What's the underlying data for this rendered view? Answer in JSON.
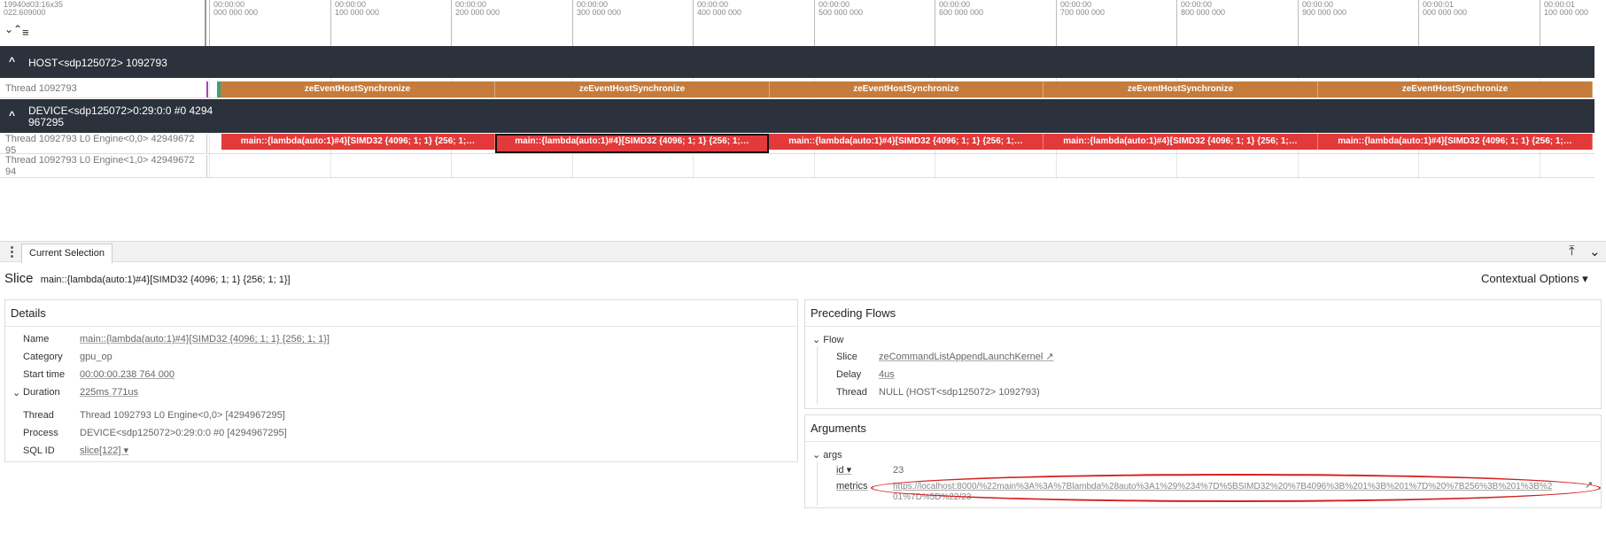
{
  "ruler": {
    "left_top": "19940d03:16x35",
    "left_bottom": "022.609000",
    "ticks": [
      {
        "a": "00:00:00",
        "b": "000 000 000"
      },
      {
        "a": "00:00:00",
        "b": "100 000 000"
      },
      {
        "a": "00:00:00",
        "b": "200 000 000"
      },
      {
        "a": "00:00:00",
        "b": "300 000 000"
      },
      {
        "a": "00:00:00",
        "b": "400 000 000"
      },
      {
        "a": "00:00:00",
        "b": "500 000 000"
      },
      {
        "a": "00:00:00",
        "b": "600 000 000"
      },
      {
        "a": "00:00:00",
        "b": "700 000 000"
      },
      {
        "a": "00:00:00",
        "b": "800 000 000"
      },
      {
        "a": "00:00:00",
        "b": "900 000 000"
      },
      {
        "a": "00:00:01",
        "b": "000 000 000"
      },
      {
        "a": "00:00:01",
        "b": "100 000 000"
      }
    ],
    "collapse_icon": "⌄⌃",
    "filter_icon": "≡"
  },
  "tracks": {
    "host_group": {
      "chevron": "^",
      "label": "HOST<sdp125072> 1092793"
    },
    "host_thread": {
      "name": "Thread 1092793",
      "slice_label": "zeEventHostSynchronize"
    },
    "device_group": {
      "chevron": "^",
      "label_line1": "DEVICE<sdp125072>0:29:0:0 #0 4294",
      "label_line2": "967295"
    },
    "engine0": {
      "name_line1": "Thread 1092793 L0 Engine<0,0> 42949672",
      "name_line2": "95",
      "slice_label": "main::{lambda(auto:1)#4}[SIMD32 {4096; 1; 1} {256; 1;…"
    },
    "engine1": {
      "name_line1": "Thread 1092793 L0 Engine<1,0> 42949672",
      "name_line2": "94"
    }
  },
  "panel": {
    "tab_label": "Current Selection",
    "kebab_icon": "⋮",
    "pin_icon": "⤒",
    "collapse_icon": "⌄",
    "title_kind": "Slice",
    "title_name": "main::{lambda(auto:1)#4}[SIMD32 {4096; 1; 1} {256; 1; 1}]",
    "contextual_options": "Contextual Options ▾"
  },
  "details": {
    "header": "Details",
    "name_key": "Name",
    "name_val": "main::{lambda(auto:1)#4}[SIMD32 {4096; 1; 1} {256; 1; 1}]",
    "category_key": "Category",
    "category_val": "gpu_op",
    "start_key": "Start time",
    "start_val": "00:00:00.238 764 000",
    "duration_key": "Duration",
    "duration_val": "225ms 771us",
    "thread_key": "Thread",
    "thread_val": "Thread 1092793 L0 Engine<0,0> [4294967295]",
    "process_key": "Process",
    "process_val": "DEVICE<sdp125072>0:29:0:0 #0 [4294967295]",
    "sqlid_key": "SQL ID",
    "sqlid_val": "slice[122] ▾"
  },
  "flows": {
    "header": "Preceding Flows",
    "group": "Flow",
    "slice_key": "Slice",
    "slice_val": "zeCommandListAppendLaunchKernel ↗",
    "delay_key": "Delay",
    "delay_val": "4us",
    "thread_key": "Thread",
    "thread_val": "NULL (HOST<sdp125072> 1092793)"
  },
  "arguments": {
    "header": "Arguments",
    "group": "args",
    "id_key": "id ▾",
    "id_val": "23",
    "metrics_key": "metrics",
    "metrics_line1": "https://localhost:8000/%22main%3A%3A%7Blambda%28auto%3A1%29%234%7D%5BSIMD32%20%7B4096%3B%201%3B%201%7D%20%7B256%3B%201%3B%2",
    "metrics_line2": "01%7D%5D%22/23"
  },
  "colors": {
    "host_slice": "#c47b3b",
    "device_slice": "#e23a3a",
    "group_header": "#2b323c",
    "annotation": "#d42020"
  }
}
